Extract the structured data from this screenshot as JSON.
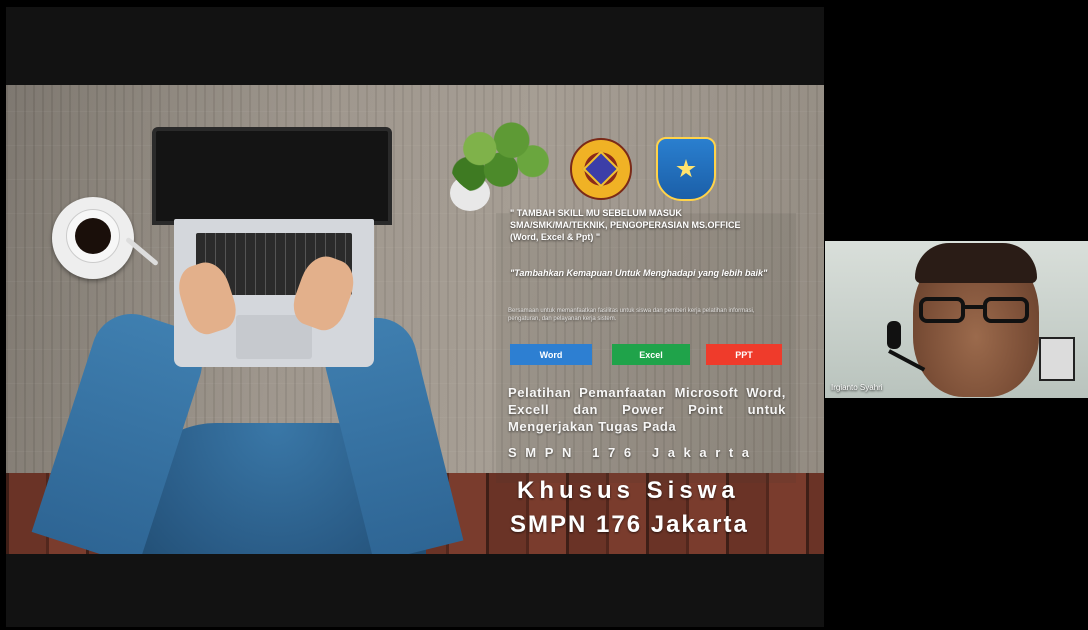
{
  "slide": {
    "tagline": "\" TAMBAH SKILL MU SEBELUM MASUK SMA/SMK/MA/TEKNIK, PENGOPERASIAN MS.OFFICE (Word, Excel & Ppt) \"",
    "quote": "\"Tambahkan Kemapuan Untuk Menghadapi yang lebih baik\"",
    "description": "Bersamaan untuk memanfaatkan fasilitas untuk siswa dan pemberi kerja pelatihan informasi, pengaturan, dan pelayanan kerja sistem.",
    "buttons": {
      "word": "Word",
      "excel": "Excel",
      "ppt": "PPT"
    },
    "title_line1": "Pelatihan Pemanfaatan Microsoft Word, Excell dan Power Point untuk Mengerjakan Tugas Pada",
    "title_line2": "SMPN 176 Jakarta",
    "headline1": "Khusus Siswa",
    "headline2": "SMPN 176 Jakarta",
    "colors": {
      "word": "#2d7fd2",
      "excel": "#1fa34a",
      "ppt": "#ef3b2b"
    }
  },
  "participant": {
    "name": "Irgianto Syahri"
  }
}
